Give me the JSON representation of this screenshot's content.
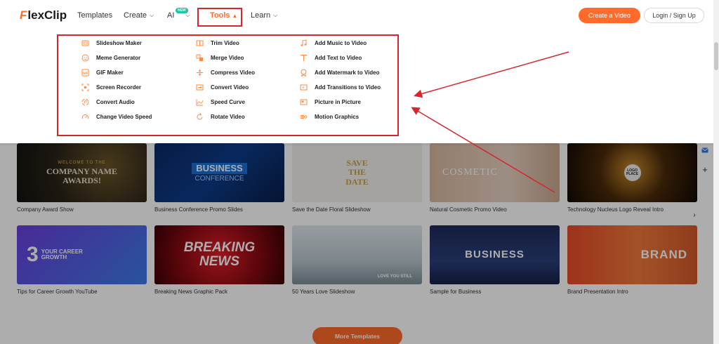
{
  "header": {
    "logo": {
      "mark": "F",
      "rest": "lexClip"
    },
    "nav": {
      "templates": "Templates",
      "create": "Create",
      "ai": "AI",
      "ai_badge": "NEW",
      "tools": "Tools",
      "learn": "Learn"
    },
    "create_video": "Create a Video",
    "login": "Login / Sign Up"
  },
  "tools_menu": {
    "col1": [
      "Slideshow Maker",
      "Meme Generator",
      "GIF Maker",
      "Screen Recorder",
      "Convert Audio",
      "Change Video Speed"
    ],
    "col2": [
      "Trim Video",
      "Merge Video",
      "Compress Video",
      "Convert Video",
      "Speed Curve",
      "Rotate Video"
    ],
    "col3": [
      "Add Music to Video",
      "Add Text to Video",
      "Add Watermark to Video",
      "Add Transitions to Video",
      "Picture in Picture",
      "Motion Graphics"
    ]
  },
  "templates_row1": [
    {
      "caption": "Company Award Show",
      "thumb_top": "WELCOME TO THE",
      "thumb_main": "COMPANY NAME AWARDS!"
    },
    {
      "caption": "Business Conference Promo Slides",
      "thumb_main": "BUSINESS",
      "thumb_sub": "CONFERENCE"
    },
    {
      "caption": "Save the Date Floral Slideshow",
      "thumb_main": "SAVE THE DATE"
    },
    {
      "caption": "Natural Cosmetic Promo Video",
      "thumb_main": "COSMETIC"
    },
    {
      "caption": "Technology Nucleus Logo Reveal Intro",
      "thumb_main": "LOGO PLACE"
    }
  ],
  "templates_row2": [
    {
      "caption": "Tips for Career Growth YouTube",
      "thumb_main": "3",
      "thumb_sub": "YOUR CAREER GROWTH"
    },
    {
      "caption": "Breaking News Graphic Pack",
      "thumb_main": "BREAKING NEWS"
    },
    {
      "caption": "50 Years Love Slideshow",
      "thumb_main": "LOVE YOU STILL"
    },
    {
      "caption": "Sample for Business",
      "thumb_main": "BUSINESS"
    },
    {
      "caption": "Brand Presentation Intro",
      "thumb_main": "BRAND"
    }
  ],
  "more_templates": "More Templates",
  "colors": {
    "accent": "#ff6b2b",
    "highlight": "#d6262c",
    "ai_badge": "#19c5a5"
  },
  "icons": [
    "chevron-down-icon",
    "chevron-up-icon",
    "chevron-right-icon",
    "plus-icon",
    "mail-icon"
  ]
}
